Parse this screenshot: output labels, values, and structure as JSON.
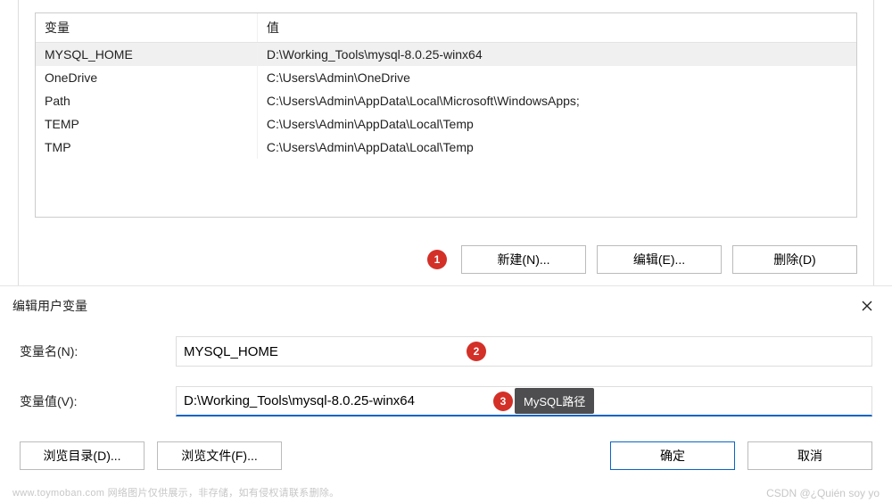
{
  "env_table": {
    "headers": {
      "variable": "变量",
      "value": "值"
    },
    "rows": [
      {
        "var": "MYSQL_HOME",
        "val": "D:\\Working_Tools\\mysql-8.0.25-winx64",
        "selected": true
      },
      {
        "var": "OneDrive",
        "val": "C:\\Users\\Admin\\OneDrive",
        "selected": false
      },
      {
        "var": "Path",
        "val": "C:\\Users\\Admin\\AppData\\Local\\Microsoft\\WindowsApps;",
        "selected": false
      },
      {
        "var": "TEMP",
        "val": "C:\\Users\\Admin\\AppData\\Local\\Temp",
        "selected": false
      },
      {
        "var": "TMP",
        "val": "C:\\Users\\Admin\\AppData\\Local\\Temp",
        "selected": false
      }
    ],
    "buttons": {
      "new": "新建(N)...",
      "edit": "编辑(E)...",
      "delete": "删除(D)"
    },
    "markers": {
      "m1": "1"
    }
  },
  "dialog": {
    "title": "编辑用户变量",
    "labels": {
      "name": "变量名(N):",
      "value": "变量值(V):"
    },
    "fields": {
      "name_value": "MYSQL_HOME",
      "value_value": "D:\\Working_Tools\\mysql-8.0.25-winx64"
    },
    "markers": {
      "m2": "2",
      "m3": "3"
    },
    "tooltip": "MySQL路径",
    "buttons": {
      "browse_dir": "浏览目录(D)...",
      "browse_file": "浏览文件(F)...",
      "ok": "确定",
      "cancel": "取消"
    }
  },
  "watermark": {
    "left": "www.toymoban.com 网络图片仅供展示，非存储，如有侵权请联系删除。",
    "right": "CSDN @¿Quién soy yo"
  }
}
